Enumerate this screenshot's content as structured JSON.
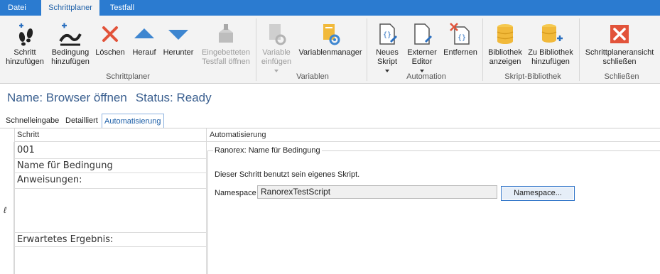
{
  "tabs": [
    {
      "label": "Datei"
    },
    {
      "label": "Schrittplaner"
    },
    {
      "label": "Testfall"
    }
  ],
  "ribbon": {
    "buttons": [
      {
        "label": "Schritt\nhinzufügen",
        "icon": "footsteps-add-icon",
        "enabled": true
      },
      {
        "label": "Bedingung\nhinzufügen",
        "icon": "condition-add-icon",
        "enabled": true
      },
      {
        "label": "Löschen",
        "icon": "delete-x-icon",
        "enabled": true
      },
      {
        "label": "Herauf",
        "icon": "arrow-up-icon",
        "enabled": true
      },
      {
        "label": "Herunter",
        "icon": "arrow-down-icon",
        "enabled": true
      },
      {
        "label": "Eingebetteten\nTestfall öffnen",
        "icon": "embedded-testcase-icon",
        "enabled": false
      },
      {
        "label": "Variable\neinfügen",
        "icon": "variable-insert-icon",
        "enabled": false
      },
      {
        "label": "Variablenmanager",
        "icon": "variable-manager-icon",
        "enabled": true
      },
      {
        "label": "Neues\nSkript",
        "icon": "new-script-icon",
        "enabled": true
      },
      {
        "label": "Externer\nEditor",
        "icon": "external-editor-icon",
        "enabled": true
      },
      {
        "label": "Entfernen",
        "icon": "remove-script-icon",
        "enabled": true
      },
      {
        "label": "Bibliothek\nanzeigen",
        "icon": "library-database-icon",
        "enabled": true
      },
      {
        "label": "Zu Bibliothek\nhinzufügen",
        "icon": "library-add-icon",
        "enabled": true
      },
      {
        "label": "Schrittplaneransicht\nschließen",
        "icon": "close-view-icon",
        "enabled": true
      }
    ],
    "groups": [
      {
        "label": "Schrittplaner"
      },
      {
        "label": "Variablen"
      },
      {
        "label": "Automation"
      },
      {
        "label": "Skript-Bibliothek"
      },
      {
        "label": "Schließen"
      }
    ]
  },
  "header": {
    "name": "Name: Browser öffnen",
    "status": "Status: Ready"
  },
  "subtabs": [
    {
      "label": "Schnelleingabe"
    },
    {
      "label": "Detailliert"
    },
    {
      "label": "Automatisierung"
    }
  ],
  "grid": {
    "col_step": "Schritt",
    "col_automation": "Automatisierung",
    "step_number": "001",
    "step_name": "Name für Bedingung",
    "instructions_label": "Anweisungen:",
    "expected_label": "Erwartetes Ergebnis:",
    "edit_marker": "ℓ"
  },
  "automation": {
    "group_title": "Ranorex: Name für Bedingung",
    "info_text": "Dieser Schritt benutzt sein eigenes Skript.",
    "namespace_label": "Namespace",
    "namespace_value": "RanorexTestScript",
    "namespace_button": "Namespace..."
  },
  "colors": {
    "tab_bar": "#2b7bd0",
    "ribbon_bg": "#f3f3f3",
    "accent_blue": "#3e86d0",
    "delete_red": "#e2533a",
    "library_yellow": "#f1b93a",
    "title_blue": "#3a5f8f"
  }
}
